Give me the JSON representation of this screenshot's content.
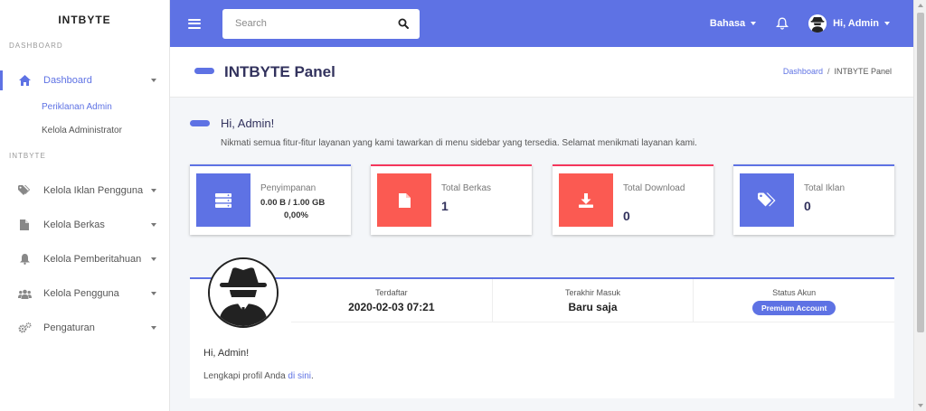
{
  "sidebar": {
    "brand": "INTBYTE",
    "section_dashboard": "DASHBOARD",
    "section_intbyte": "INTBYTE",
    "dashboard": {
      "label": "Dashboard",
      "icon": "home-icon"
    },
    "sub_items": [
      "Periklanan Admin",
      "Kelola Administrator"
    ],
    "items": [
      {
        "label": "Kelola Iklan Pengguna",
        "icon": "tags-icon"
      },
      {
        "label": "Kelola Berkas",
        "icon": "file-icon"
      },
      {
        "label": "Kelola Pemberitahuan",
        "icon": "bell-icon"
      },
      {
        "label": "Kelola Pengguna",
        "icon": "users-icon"
      },
      {
        "label": "Pengaturan",
        "icon": "cogs-icon"
      }
    ]
  },
  "topbar": {
    "search_placeholder": "Search",
    "language": "Bahasa",
    "user_greeting": "Hi, Admin"
  },
  "page_header": {
    "title": "INTBYTE Panel",
    "breadcrumb_home": "Dashboard",
    "breadcrumb_sep": "/",
    "breadcrumb_current": "INTBYTE Panel"
  },
  "greeting": {
    "title": "Hi, Admin!",
    "text": "Nikmati semua fitur-fitur layanan yang kami tawarkan di menu sidebar yang tersedia. Selamat menikmati layanan kami."
  },
  "cards": {
    "storage": {
      "label": "Penyimpanan",
      "usage": "0.00 B / 1.00 GB",
      "percent": "0,00%",
      "icon": "database-icon"
    },
    "files": {
      "label": "Total Berkas",
      "value": "1",
      "icon": "file-icon"
    },
    "downloads": {
      "label": "Total Download",
      "value": "0",
      "icon": "download-icon"
    },
    "ads": {
      "label": "Total Iklan",
      "value": "0",
      "icon": "tags-icon"
    }
  },
  "profile": {
    "registered_label": "Terdaftar",
    "registered_value": "2020-02-03 07:21",
    "last_login_label": "Terakhir Masuk",
    "last_login_value": "Baru saja",
    "status_label": "Status Akun",
    "status_value": "Premium Account",
    "greeting": "Hi, Admin!",
    "complete_text": "Lengkapi profil Anda",
    "complete_link": "di sini",
    "complete_end": "."
  },
  "colors": {
    "primary": "#5e72e4",
    "danger": "#f5365c",
    "card_red": "#fb5a52",
    "dark": "#32325d"
  }
}
